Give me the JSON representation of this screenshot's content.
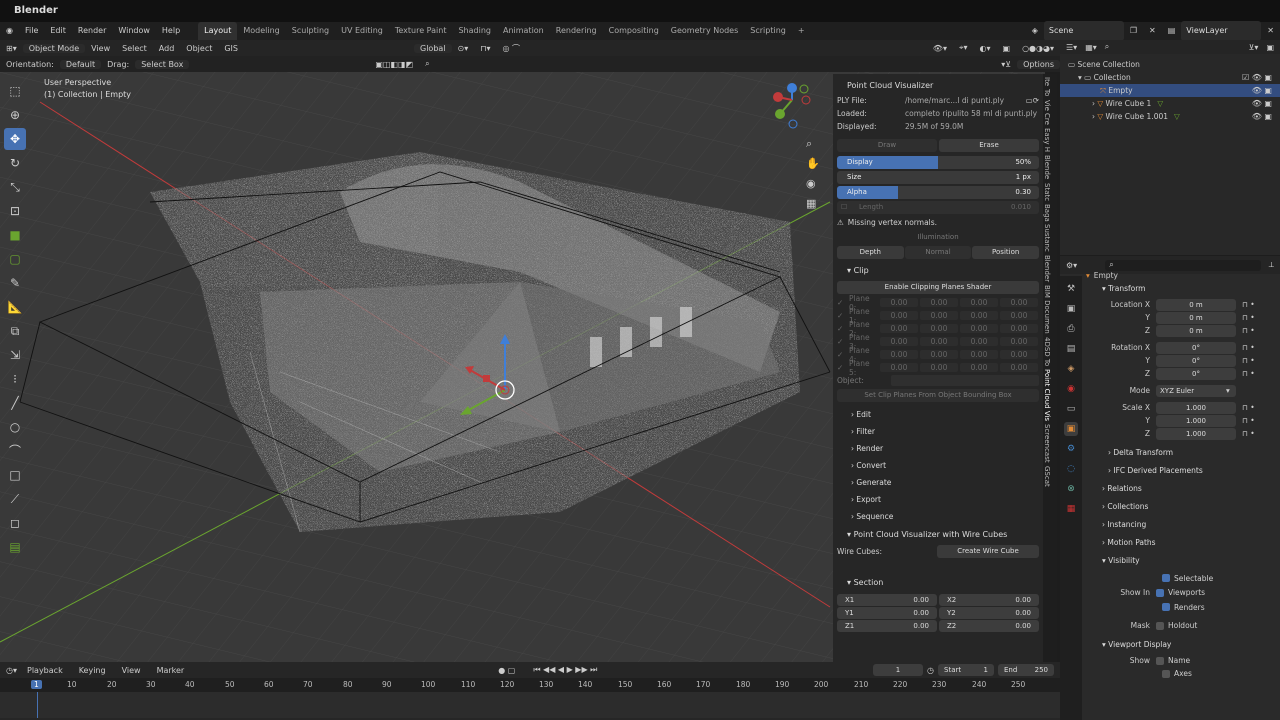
{
  "app": {
    "title": "Blender"
  },
  "menu": {
    "items": [
      "File",
      "Edit",
      "Render",
      "Window",
      "Help"
    ]
  },
  "workspaces": [
    "Layout",
    "Modeling",
    "Sculpting",
    "UV Editing",
    "Texture Paint",
    "Shading",
    "Animation",
    "Rendering",
    "Compositing",
    "Geometry Nodes",
    "Scripting"
  ],
  "workspace_add": "+",
  "scene": {
    "name": "Scene",
    "view_layer": "ViewLayer"
  },
  "viewport_header": {
    "mode": "Object Mode",
    "menus": [
      "View",
      "Select",
      "Add",
      "Object",
      "GIS"
    ],
    "transform": "Global",
    "orientation_label": "Orientation:",
    "orientation_value": "Default",
    "drag_label": "Drag:",
    "drag_value": "Select Box",
    "options": "Options"
  },
  "viewport": {
    "view_name": "User Perspective",
    "collection_info": "(1) Collection | Empty"
  },
  "pcv": {
    "panel_title": "Point Cloud Visualizer",
    "ply_label": "PLY File:",
    "ply_value": "/home/marc...l di punti.ply",
    "loaded_label": "Loaded:",
    "loaded_value": "completo ripulito 58 ml di punti.ply",
    "displayed_label": "Displayed:",
    "displayed_value": "29.5M of 59.0M",
    "draw": "Draw",
    "erase": "Erase",
    "display_label": "Display",
    "display_value": "50%",
    "display_fraction": 0.5,
    "size_label": "Size",
    "size_value": "1 px",
    "alpha_label": "Alpha",
    "alpha_value": "0.30",
    "alpha_fraction": 0.3,
    "length_label": "Length",
    "length_value": "0.010",
    "warning": "Missing vertex normals.",
    "illumination": "Illumination",
    "depth": "Depth",
    "normal": "Normal",
    "position": "Position",
    "clip_title": "Clip",
    "enable_clipping": "Enable Clipping Planes Shader",
    "planes": [
      {
        "label": "Plane 0:",
        "v": [
          "0.00",
          "0.00",
          "0.00",
          "0.00"
        ]
      },
      {
        "label": "Plane 1:",
        "v": [
          "0.00",
          "0.00",
          "0.00",
          "0.00"
        ]
      },
      {
        "label": "Plane 2:",
        "v": [
          "0.00",
          "0.00",
          "0.00",
          "0.00"
        ]
      },
      {
        "label": "Plane 3:",
        "v": [
          "0.00",
          "0.00",
          "0.00",
          "0.00"
        ]
      },
      {
        "label": "Plane 4:",
        "v": [
          "0.00",
          "0.00",
          "0.00",
          "0.00"
        ]
      },
      {
        "label": "Plane 5:",
        "v": [
          "0.00",
          "0.00",
          "0.00",
          "0.00"
        ]
      }
    ],
    "object_label": "Object:",
    "set_clip": "Set Clip Planes From Object Bounding Box",
    "subpanels": [
      "Edit",
      "Filter",
      "Render",
      "Convert",
      "Generate",
      "Export",
      "Sequence"
    ],
    "wire_title": "Point Cloud Visualizer with Wire Cubes",
    "wire_label": "Wire Cubes:",
    "wire_button": "Create Wire Cube",
    "section_title": "Section",
    "section": [
      {
        "a": "X1",
        "av": "0.00",
        "b": "X2",
        "bv": "0.00"
      },
      {
        "a": "Y1",
        "av": "0.00",
        "b": "Y2",
        "bv": "0.00"
      },
      {
        "a": "Z1",
        "av": "0.00",
        "b": "Z2",
        "bv": "0.00"
      }
    ]
  },
  "vtabs": [
    "Ite",
    "To",
    "Vie",
    "Cre",
    "Easy H",
    "Blende",
    "Statc",
    "Baga",
    "Sustanc",
    "Blender",
    "BIM Documen",
    "4DSD To",
    "Point Cloud Vis",
    "Screencast",
    "GScat"
  ],
  "outliner": {
    "scene_collection": "Scene Collection",
    "collection": "Collection",
    "items": [
      "Empty",
      "Wire Cube 1",
      "Wire Cube 1.001"
    ]
  },
  "props": {
    "object_name": "Empty",
    "transform": "Transform",
    "location_label": "Location X",
    "location": [
      "0 m",
      "0 m",
      "0 m"
    ],
    "rotation_label": "Rotation X",
    "rotation": [
      "0°",
      "0°",
      "0°"
    ],
    "mode_label": "Mode",
    "mode_value": "XYZ Euler",
    "scale_label": "Scale X",
    "scale": [
      "1.000",
      "1.000",
      "1.000"
    ],
    "y": "Y",
    "z": "Z",
    "delta": "Delta Transform",
    "ifc": "IFC Derived Placements",
    "sections": [
      "Relations",
      "Collections",
      "Instancing",
      "Motion Paths"
    ],
    "visibility": "Visibility",
    "selectable": "Selectable",
    "show_in": "Show In",
    "viewports": "Viewports",
    "renders": "Renders",
    "mask": "Mask",
    "holdout": "Holdout",
    "viewport_display": "Viewport Display",
    "show": "Show",
    "name": "Name",
    "axes": "Axes"
  },
  "timeline": {
    "menus": [
      "Playback",
      "Keying",
      "View",
      "Marker"
    ],
    "current_frame": "1",
    "start_label": "Start",
    "start": "1",
    "end_label": "End",
    "end": "250",
    "ticks": [
      "1",
      "10",
      "20",
      "30",
      "40",
      "50",
      "60",
      "70",
      "80",
      "90",
      "100",
      "110",
      "120",
      "130",
      "140",
      "150",
      "160",
      "170",
      "180",
      "190",
      "200",
      "210",
      "220",
      "230",
      "240",
      "250"
    ]
  },
  "colors": {
    "accent": "#4772b3",
    "x_axis": "#c23b3b",
    "y_axis": "#6aa52f",
    "z_axis": "#3f7fd9",
    "object_orange": "#e08a36"
  }
}
